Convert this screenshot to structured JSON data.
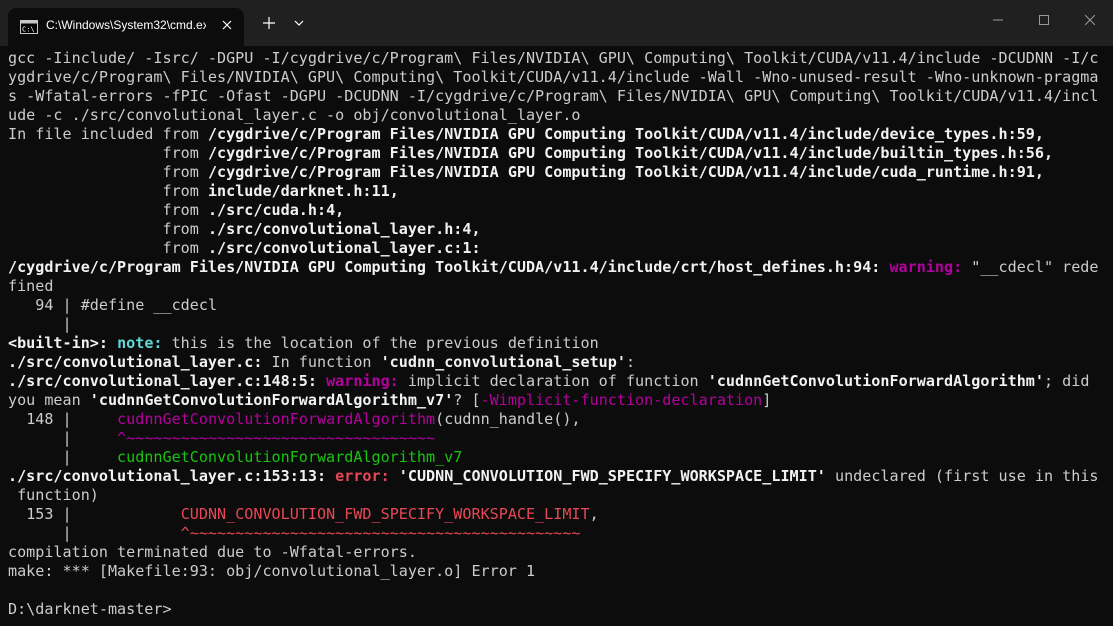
{
  "window": {
    "tab_title": "C:\\Windows\\System32\\cmd.ex",
    "new_tab_label": "+",
    "dropdown_icon": "chevron-down-icon",
    "min_icon": "minimize-icon",
    "max_icon": "maximize-icon",
    "close_icon": "close-icon"
  },
  "colors": {
    "background": "#0c0c0c",
    "titlebar": "#202020",
    "text": "#cccccc",
    "warning": "#b4009e",
    "note": "#61d6d6",
    "error": "#e74856",
    "fixit": "#16c60c"
  },
  "console": {
    "cmd_1": "gcc -Iinclude/ -Isrc/ -DGPU -I/cygdrive/c/Program\\ Files/NVIDIA\\ GPU\\ Computing\\ Toolkit/CUDA/v11.4/include -DCUDNN -I/c",
    "cmd_2": "ygdrive/c/Program\\ Files/NVIDIA\\ GPU\\ Computing\\ Toolkit/CUDA/v11.4/include -Wall -Wno-unused-result -Wno-unknown-pragma",
    "cmd_3": "s -Wfatal-errors -fPIC -Ofast -DGPU -DCUDNN -I/cygdrive/c/Program\\ Files/NVIDIA\\ GPU\\ Computing\\ Toolkit/CUDA/v11.4/incl",
    "cmd_4": "ude -c ./src/convolutional_layer.c -o obj/convolutional_layer.o",
    "incl_1_pre": "In file included from ",
    "incl_1_file": "/cygdrive/c/Program Files/NVIDIA GPU Computing Toolkit/CUDA/v11.4/include/device_types.h:59",
    "incl_2_file": "/cygdrive/c/Program Files/NVIDIA GPU Computing Toolkit/CUDA/v11.4/include/builtin_types.h:56",
    "incl_3_file": "/cygdrive/c/Program Files/NVIDIA GPU Computing Toolkit/CUDA/v11.4/include/cuda_runtime.h:91",
    "incl_4_file": "include/darknet.h:11",
    "incl_5_file": "./src/cuda.h:4",
    "incl_6_file": "./src/convolutional_layer.h:4",
    "incl_7_file": "./src/convolutional_layer.c:1",
    "from_word": "from",
    "w1_loc": "/cygdrive/c/Program Files/NVIDIA GPU Computing Toolkit/CUDA/v11.4/include/crt/host_defines.h:94:",
    "w1_label": "warning:",
    "w1_msg_a": " \"__cdecl\" rede",
    "w1_msg_b": "fined",
    "src94_no": "94",
    "src94_code": "#define __cdecl",
    "note_loc": "<built-in>:",
    "note_label": "note:",
    "note_msg": " this is the location of the previous definition",
    "func_loc": "./src/convolutional_layer.c:",
    "func_msg": " In function ",
    "func_name": "'cudnn_convolutional_setup'",
    "func_colon": ":",
    "w2_loc": "./src/convolutional_layer.c:148:5:",
    "w2_label": "warning:",
    "w2_msg_a": " implicit declaration of function ",
    "w2_ident": "'cudnnGetConvolutionForwardAlgorithm'",
    "w2_msg_b": "; did",
    "w2_msg_c": "you mean ",
    "w2_suggest": "'cudnnGetConvolutionForwardAlgorithm_v7'",
    "w2_msg_d": "? [",
    "w2_flag": "-Wimplicit-function-declaration",
    "w2_msg_e": "]",
    "src148_no": "148",
    "src148_ident": "cudnnGetConvolutionForwardAlgorithm",
    "src148_rest": "(cudnn_handle(),",
    "caret148": "^~~~~~~~~~~~~~~~~~~~~~~~~~~~~~~~~~~",
    "fixit148": "cudnnGetConvolutionForwardAlgorithm_v7",
    "e1_loc": "./src/convolutional_layer.c:153:13:",
    "e1_label": "error:",
    "e1_msg_a": " ",
    "e1_ident": "'CUDNN_CONVOLUTION_FWD_SPECIFY_WORKSPACE_LIMIT'",
    "e1_msg_b": " undeclared (first use in this",
    "e1_msg_c": " function)",
    "src153_no": "153",
    "src153_ident": "CUDNN_CONVOLUTION_FWD_SPECIFY_WORKSPACE_LIMIT",
    "src153_rest": ",",
    "caret153": "^~~~~~~~~~~~~~~~~~~~~~~~~~~~~~~~~~~~~~~~~~~~",
    "terminated": "compilation terminated due to -Wfatal-errors.",
    "make_err": "make: *** [Makefile:93: obj/convolutional_layer.o] Error 1",
    "prompt": "D:\\darknet-master>"
  }
}
